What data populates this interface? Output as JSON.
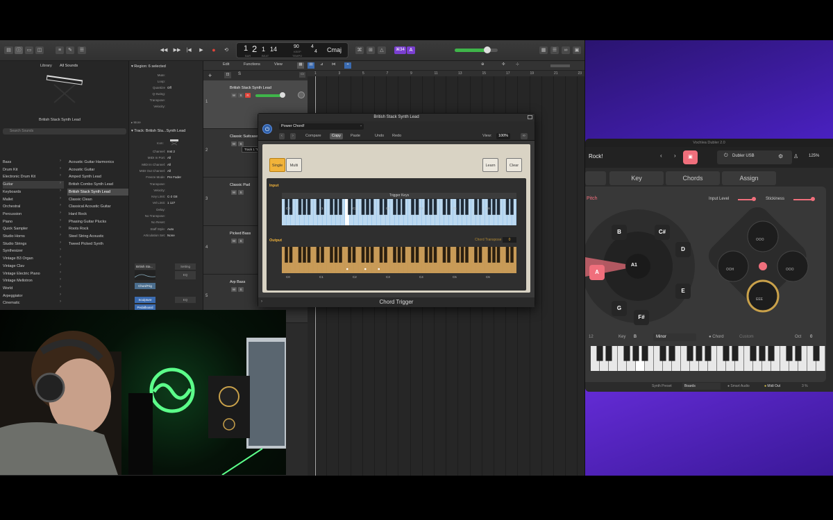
{
  "colors": {
    "accent_purple": "#7a3fd0",
    "record_red": "#e0443a",
    "logic_green": "#3fb54a",
    "chord_orange": "#f1b33a",
    "dubler_pink": "#f06f7c"
  },
  "toolbar": {
    "lcd": {
      "bar": "1",
      "beat": "2",
      "div": "1",
      "tick": "14",
      "tempo": "90",
      "tempo_label": "KEEP",
      "sig_top": "4",
      "sig_bottom": "4",
      "key": "Cmaj",
      "bar_label": "BAR",
      "beat_label": "BEAT",
      "tempo_lbl": "TEMPO"
    },
    "badge_count": "⌘34",
    "badge_icon": "A"
  },
  "library": {
    "title": "Library",
    "dropdown": "All Sounds",
    "preview_caption": "British Stack Synth Lead",
    "search_placeholder": "Search Sounds",
    "categories": [
      "Bass",
      "Drum Kit",
      "Electronic Drum Kit",
      "Guitar",
      "Keyboards",
      "Mallet",
      "Orchestral",
      "Percussion",
      "Piano",
      "Quick Sampler",
      "Studio Horns",
      "Studio Strings",
      "Synthesizer",
      "Vintage B3 Organ",
      "Vintage Clav",
      "Vintage Electric Piano",
      "Vintage Mellotron",
      "World",
      "Arpeggiator",
      "Cinematic"
    ],
    "patches": [
      "Acoustic Guitar Harmonics",
      "Acoustic Guitar",
      "Amped Synth Lead",
      "British Combo Synth Lead",
      "British Stack Synth Lead",
      "Classic Clean",
      "Classical Acoustic Guitar",
      "Hard Rock",
      "Phasing Guitar Plucks",
      "Roots Rock",
      "Steel String Acoustic",
      "Tweed Picked Synth"
    ]
  },
  "inspector": {
    "region_label": "Region:",
    "region_value": "6 selected",
    "region_rows": [
      [
        "Mute:",
        ""
      ],
      [
        "Loop:",
        ""
      ],
      [
        "Quantize",
        "Off"
      ],
      [
        "Q-Swing:",
        ""
      ],
      [
        "Transpose:",
        ""
      ],
      [
        "Velocity:",
        ""
      ]
    ],
    "more": "More",
    "track_label": "Track:",
    "track_value": "British Sta...Synth Lead",
    "icon_label": "Icon:",
    "track_rows": [
      [
        "Channel:",
        "Inst 2"
      ],
      [
        "MIDI In Port:",
        "All"
      ],
      [
        "MIDI In Channel:",
        "All"
      ],
      [
        "MIDI Out Channel:",
        "All"
      ],
      [
        "Freeze Mode:",
        "Pre Fader"
      ],
      [
        "Transpose:",
        ""
      ],
      [
        "Velocity:",
        ""
      ],
      [
        "Key Limit:",
        "C-2  G8"
      ],
      [
        "Vel Limit:",
        "1  127"
      ],
      [
        "Delay:",
        ""
      ],
      [
        "No Transpose:",
        ""
      ],
      [
        "No Reset:",
        ""
      ],
      [
        "Staff Style:",
        "Auto"
      ],
      [
        "Articulation Set:",
        "None"
      ]
    ],
    "strip_name": "British Sta...",
    "strip_setting": "Setting",
    "chordtrig": "ChordTrig",
    "sculpture": "Sculpture",
    "pedalboard": "Pedalboard",
    "eq": "EQ",
    "strip_btns": [
      "M",
      "S",
      "R",
      "I"
    ]
  },
  "subtool": {
    "edit": "Edit",
    "functions": "Functions",
    "view": "View",
    "add": "+",
    "s": "S"
  },
  "ruler": [
    "1",
    "3",
    "5",
    "7",
    "9",
    "11",
    "13",
    "15",
    "17",
    "19",
    "21",
    "23"
  ],
  "tracks": [
    {
      "num": "1",
      "name": "British Stack Synth Lead"
    },
    {
      "num": "2",
      "name": "Classic Suitcase"
    },
    {
      "num": "3",
      "name": "Classic Pad"
    },
    {
      "num": "4",
      "name": "Picked Bass"
    },
    {
      "num": "5",
      "name": "Arp Bass"
    }
  ],
  "track_buttons": {
    "m": "M",
    "s": "S",
    "r": "R"
  },
  "tooltip": "Track 1 \"British Stack Synth Lead\"",
  "plugin": {
    "title": "British Stack Synth Lead",
    "preset": "Power Chord!",
    "buttons": [
      "Compare",
      "Copy",
      "Paste",
      "Undo",
      "Redo"
    ],
    "view_label": "View:",
    "view_value": "100%",
    "modes": [
      "Single",
      "Multi"
    ],
    "learn": "Learn",
    "clear": "Clear",
    "input_label": "Input",
    "trigger_keys": "Trigger Keys",
    "output_label": "Output",
    "chord_transpose": "Chord Transpose",
    "transpose_value": "0",
    "octaves": [
      "C0",
      "C1",
      "C2",
      "C3",
      "C4",
      "C5",
      "C6"
    ],
    "footer": "Chord Trigger"
  },
  "dubler": {
    "title": "Vochlea Dubler 2.0",
    "preset": "Rock!",
    "device": "Dubler USB",
    "zoom": "125%",
    "tabs": [
      "Key",
      "Chords",
      "Assign"
    ],
    "pitch": "Pitch",
    "input_level": "Input Level",
    "stickiness": "Stickiness",
    "notes": [
      "A",
      "B",
      "C#",
      "D",
      "E",
      "F#",
      "G"
    ],
    "center_note": "A1",
    "pads": [
      "OOO",
      "OOH",
      "OOO",
      "EEE"
    ],
    "key_label": "Key",
    "key_value": "B",
    "scale": "Minor",
    "chord_label": "Chord",
    "chord_value": "Custom",
    "oct_label": "Oct",
    "oct_value": "0",
    "left_num": "12",
    "synth_preset_label": "Synth Preset",
    "synth_preset": "Boards",
    "smart_mode": "Smart Audio",
    "midi_out": "Midi Out",
    "percent": "3 %"
  }
}
